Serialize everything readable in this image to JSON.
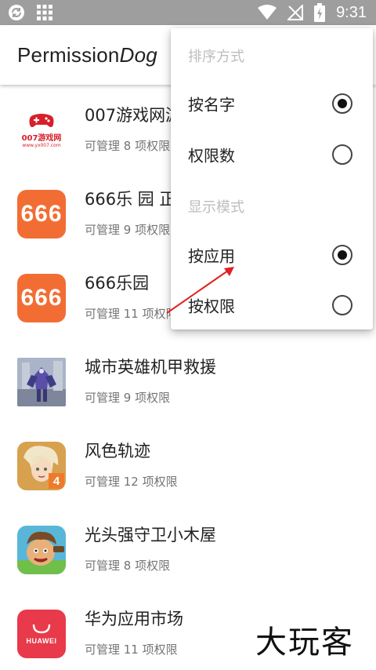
{
  "status_bar": {
    "time": "9:31",
    "icons": [
      "sync-icon",
      "grid-icon",
      "wifi-icon",
      "no-signal-icon",
      "battery-icon"
    ],
    "background": "#9e9e9e"
  },
  "app_bar": {
    "title_regular": "Permission",
    "title_italic": "Dog"
  },
  "apps": [
    {
      "name": "007游戏网游",
      "perms": "可管理 8 项权限",
      "icon": "icon-007",
      "icon_text": "007游戏网",
      "icon_subtext": "www.yx007.com"
    },
    {
      "name": "666乐 园 正",
      "perms": "可管理 9 项权限",
      "icon": "icon-666",
      "icon_text": "666"
    },
    {
      "name": "666乐园",
      "perms": "可管理 11 项权限",
      "icon": "icon-666",
      "icon_text": "666"
    },
    {
      "name": "城市英雄机甲救援",
      "perms": "可管理 9 项权限",
      "icon": "mech-icon"
    },
    {
      "name": "风色轨迹",
      "perms": "可管理 12 项权限",
      "icon": "anime-game-icon"
    },
    {
      "name": "光头强守卫小木屋",
      "perms": "可管理 8 项权限",
      "icon": "cartoon-game-icon"
    },
    {
      "name": "华为应用市场",
      "perms": "可管理 11 项权限",
      "icon": "huawei-icon",
      "icon_text": "HUAWEI"
    }
  ],
  "popup": {
    "sort_header": "排序方式",
    "sort_by_name": "按名字",
    "sort_by_perm_count": "权限数",
    "display_header": "显示模式",
    "display_by_app": "按应用",
    "display_by_permission": "按权限",
    "sort_by_name_checked": true,
    "sort_by_perm_count_checked": false,
    "display_by_app_checked": true,
    "display_by_permission_checked": false
  },
  "watermark": "大玩客",
  "colors": {
    "accent_orange": "#f26d34",
    "huawei_red": "#e83a4a",
    "annotation_arrow": "#e02020"
  }
}
